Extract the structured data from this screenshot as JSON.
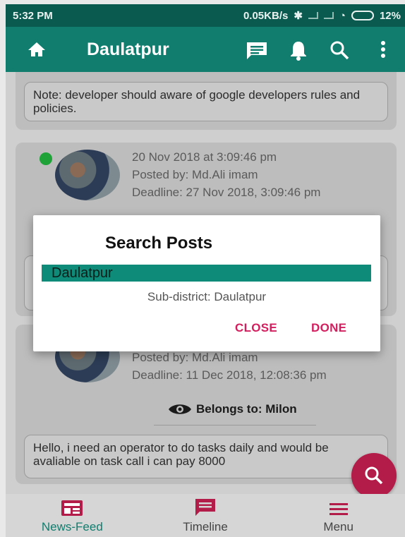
{
  "status_bar": {
    "time": "5:32 PM",
    "net_speed": "0.05KB/s",
    "battery": "12%"
  },
  "app_bar": {
    "title": "Daulatpur"
  },
  "feed": {
    "note_partial": "Note: developer should aware of google developers rules and policies.",
    "post1": {
      "date": "20 Nov 2018 at 3:09:46 pm",
      "posted_by": "Posted by: Md.Ali imam",
      "deadline": "Deadline: 27 Nov 2018, 3:09:46 pm"
    },
    "post2": {
      "posted_by": "Posted by: Md.Ali imam",
      "deadline": "Deadline: 11 Dec 2018, 12:08:36 pm",
      "belongs_to": "Belongs to: Milon",
      "body": "Hello, i need an operator to do tasks daily and would be avaliable on task call i can pay  8000"
    }
  },
  "dialog": {
    "title": "Search Posts",
    "selected_district": "Daulatpur",
    "sub_district": "Sub-district: Daulatpur",
    "close_label": "CLOSE",
    "done_label": "DONE"
  },
  "bottom_nav": {
    "items": [
      {
        "label": "News-Feed",
        "icon": "newspaper-icon"
      },
      {
        "label": "Timeline",
        "icon": "message-icon"
      },
      {
        "label": "Menu",
        "icon": "menu-icon"
      }
    ]
  },
  "colors": {
    "primary": "#117d6e",
    "accent": "#d31f5e",
    "fab": "#b31b48"
  }
}
